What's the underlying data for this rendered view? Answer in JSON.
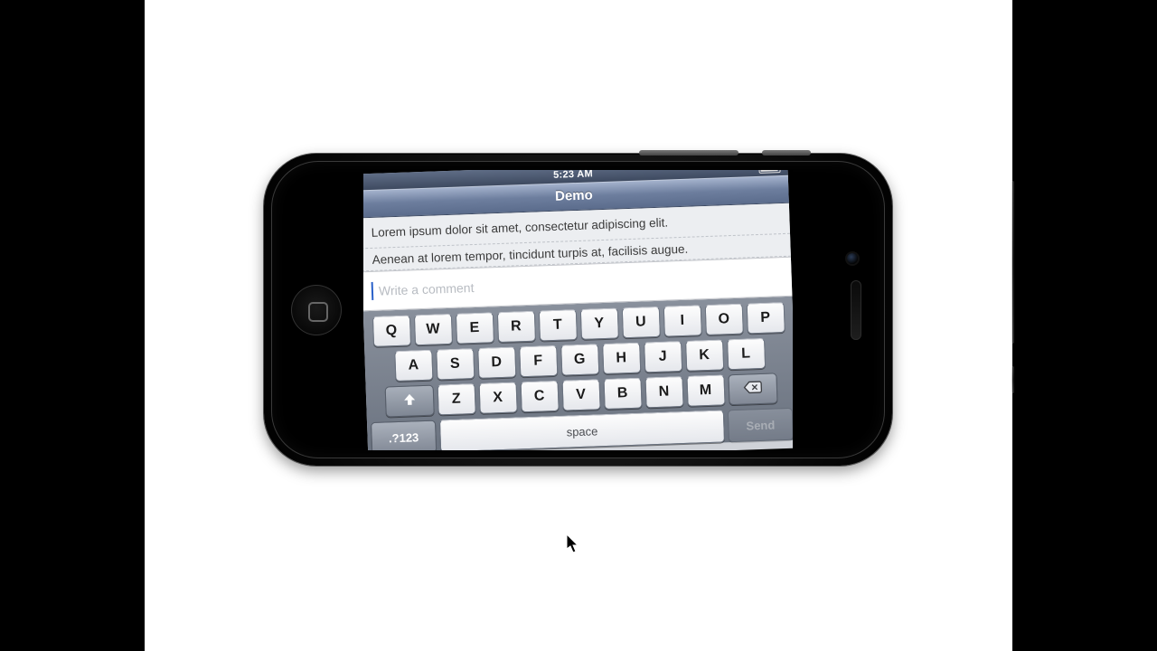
{
  "status": {
    "time": "5:23 AM"
  },
  "nav": {
    "title": "Demo"
  },
  "content": {
    "line1": "Lorem ipsum dolor sit amet, consectetur adipiscing elit.",
    "line2": "Aenean at lorem tempor, tincidunt turpis at, facilisis augue."
  },
  "comment": {
    "placeholder": "Write a comment"
  },
  "keyboard": {
    "row1": [
      "Q",
      "W",
      "E",
      "R",
      "T",
      "Y",
      "U",
      "I",
      "O",
      "P"
    ],
    "row2": [
      "A",
      "S",
      "D",
      "F",
      "G",
      "H",
      "J",
      "K",
      "L"
    ],
    "row3": [
      "Z",
      "X",
      "C",
      "V",
      "B",
      "N",
      "M"
    ],
    "mode_label": ".?123",
    "space_label": "space",
    "send_label": "Send"
  }
}
